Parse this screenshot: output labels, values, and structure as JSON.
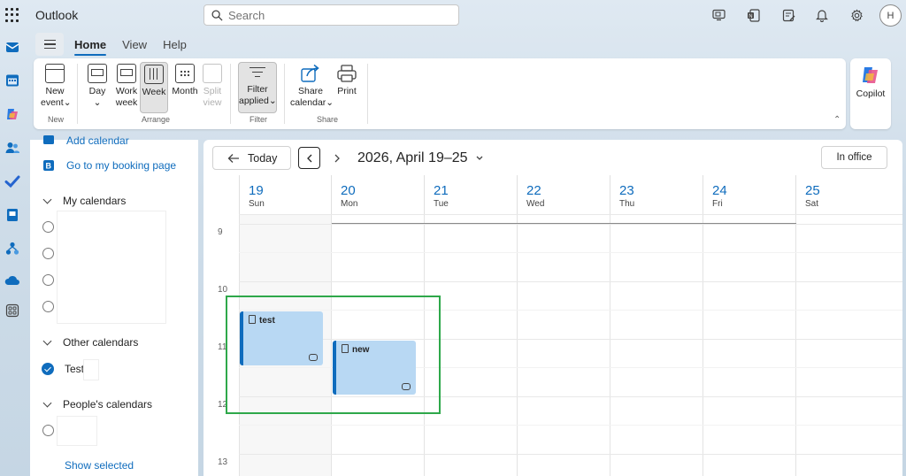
{
  "app": {
    "title": "Outlook"
  },
  "search": {
    "placeholder": "Search"
  },
  "user": {
    "initial": "H"
  },
  "ribbon": {
    "tabs": [
      "Home",
      "View",
      "Help"
    ],
    "new_event": {
      "line1": "New",
      "line2": "event"
    },
    "group_new": "New",
    "day": "Day",
    "work_week": {
      "line1": "Work",
      "line2": "week"
    },
    "week": "Week",
    "month": "Month",
    "split_view": {
      "line1": "Split",
      "line2": "view"
    },
    "group_arrange": "Arrange",
    "filter": {
      "line1": "Filter",
      "line2": "applied"
    },
    "group_filter": "Filter",
    "share_calendar": {
      "line1": "Share",
      "line2": "calendar"
    },
    "print": "Print",
    "group_share": "Share",
    "copilot": "Copilot"
  },
  "leftpane": {
    "add_calendar": "Add calendar",
    "booking": "Go to my booking page",
    "my_calendars": "My calendars",
    "other_calendars": "Other calendars",
    "other_items": [
      "Test"
    ],
    "peoples_calendars": "People's calendars",
    "show_selected": "Show selected"
  },
  "calendar": {
    "today": "Today",
    "range": "2026, April 19–25",
    "in_office": "In office",
    "days": [
      {
        "num": "19",
        "name": "Sun"
      },
      {
        "num": "20",
        "name": "Mon"
      },
      {
        "num": "21",
        "name": "Tue"
      },
      {
        "num": "22",
        "name": "Wed"
      },
      {
        "num": "23",
        "name": "Thu"
      },
      {
        "num": "24",
        "name": "Fri"
      },
      {
        "num": "25",
        "name": "Sat"
      }
    ],
    "hours": [
      "9",
      "10",
      "11",
      "12",
      "13"
    ],
    "events": [
      {
        "title": "test",
        "day": "Sun",
        "recurring": true
      },
      {
        "title": "new",
        "day": "Mon",
        "recurring": true
      }
    ]
  },
  "colors": {
    "accent": "#0f6cbd",
    "event_bg": "#b8d8f3",
    "highlight": "#2ea84a"
  }
}
